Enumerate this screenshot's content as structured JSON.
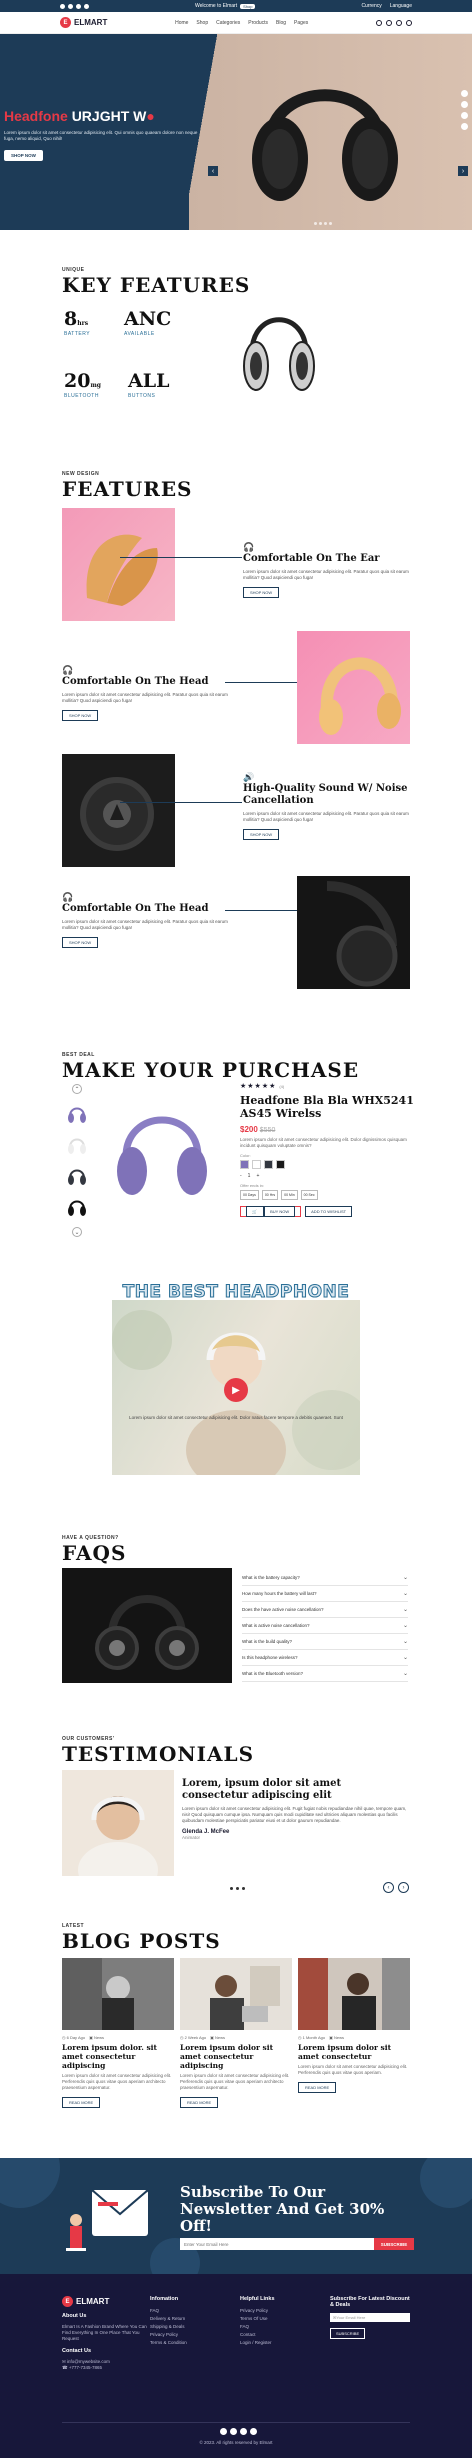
{
  "topbar": {
    "welcome": "Welcome to Elmart",
    "pill": "Shop",
    "currency": "Currency",
    "language": "Language"
  },
  "nav": {
    "logo": "ELMART",
    "menu": [
      "Home",
      "Shop",
      "Categories",
      "Products",
      "Blog",
      "Pages"
    ]
  },
  "hero": {
    "title_a": "Headfone ",
    "title_b": "URJGHT W",
    "desc": "Lorem ipsum dolor sit amet consectetur adipisicing elit. Qui omnis quo quaeam dolore non neque fuga, nemo aliquid, Quo nihil!",
    "button": "SHOP NOW",
    "prev": "‹",
    "next": "›"
  },
  "key_features": {
    "kicker": "UNIQUE",
    "heading": "KEY FEATURES",
    "stats": [
      {
        "num": "8",
        "unit": "hrs",
        "label": "BATTERY"
      },
      {
        "num": "ANC",
        "unit": "",
        "label": "AVAILABLE"
      },
      {
        "num": "20",
        "unit": "mg",
        "label": "BLUETOOTH"
      },
      {
        "num": "ALL",
        "unit": "",
        "label": "BUTTONS"
      }
    ]
  },
  "features": {
    "kicker": "NEW DESIGN",
    "heading": "FEATURES",
    "items": [
      {
        "title": "Comfortable On The Ear",
        "desc": "Lorem ipsum dolor sit amet consectetur adipisicing elit. Paratur quos quia sit earum mollitia? Quod aspiciendi quo fuga!",
        "button": "SHOP NOW"
      },
      {
        "title": "Comfortable On The Head",
        "desc": "Lorem ipsum dolor sit amet consectetur adipisicing elit. Paratur quos quia sit earum mollitia? Quod aspiciendi quo fuga!",
        "button": "SHOP NOW"
      },
      {
        "title": "High-Quality Sound W/ Noise Cancellation",
        "desc": "Lorem ipsum dolor sit amet consectetur adipisicing elit. Paratur quos quia sit earum mollitia? Quod aspiciendi quo fuga!",
        "button": "SHOP NOW"
      },
      {
        "title": "Comfortable On The Head",
        "desc": "Lorem ipsum dolor sit amet consectetur adipisicing elit. Paratur quos quia sit earum mollitia? Quod aspiciendi quo fuga!",
        "button": "SHOP NOW"
      }
    ]
  },
  "purchase": {
    "kicker": "BEST DEAL",
    "heading": "MAKE YOUR PURCHASE",
    "stars": "★★★★★",
    "reviews": "(4)",
    "title": "Headfone Bla Bla WHX5241 AS45 Wirelss",
    "price": "$200",
    "old_price": "$550",
    "desc": "Lorem ipsum dolor sit amet consectetur adipisicing elit. Dolor dignissimos quisquam incidunt quisquam voluptate omnis?",
    "color_label": "Color:",
    "qty_minus": "-",
    "qty": "1",
    "qty_plus": "+",
    "offer_label": "Offer ends in:",
    "offers": [
      "00 Days",
      "00 Hrs",
      "00 Min",
      "00 Sec"
    ],
    "buy": "BUY NOW",
    "wishlist": "ADD TO WISHLIST",
    "colors": [
      "#7f72b8",
      "#ffffff",
      "#333740",
      "#1a1a1a"
    ]
  },
  "video": {
    "title": "THE BEST HEADPHONE",
    "caption": "Lorem ipsum dolor sit amet consectetur adipisicing elit. Dolor natus facere tempore a debitis quaeraet. Sunt"
  },
  "faq": {
    "kicker": "HAVE A QUESTION?",
    "heading": "FAQS",
    "items": [
      "What is the battery capacity?",
      "How many hours the battery will last?",
      "Does the have active noise cancellation?",
      "What is active noise cancellation?",
      "What is the build quality?",
      "Is this headphone wireless?",
      "What is the Bluetooth version?"
    ]
  },
  "testimonials": {
    "kicker": "OUR CUSTOMERS'",
    "heading": "TESTIMONIALS",
    "quote": "Lorem, ipsum dolor sit amet consectetur adipiscing elit",
    "desc": "Lorem ipsum dolor sit amet consectetur adipisicing elit. Fugit fugiat nobis repudiandae nihil quae, tempore quam, nisi! Quod quisquam cumque ipsa. Numquam quis modi cupiditate sed ultricies aliquam molestias quo facilis quibusdam molestiae perspiciatis pariatur eiusi et ut dolor gaurum repudiandae.",
    "name": "Glenda J. McFee",
    "role": "Animator"
  },
  "blog": {
    "kicker": "LATEST",
    "heading": "BLOG POSTS",
    "posts": [
      {
        "date": "6 Day Ago",
        "tag": "News",
        "title": "Lorem ipsum dolor. sit amet consectetur adipiscing",
        "desc": "Lorem ipsum dolor sit amet consectetur adipisicing elit. Perferendis quis quos vitae quos aperiam architecto praesentium aspernatur.",
        "button": "READ MORE"
      },
      {
        "date": "2 Week Ago",
        "tag": "News",
        "title": "Lorem ipsum dolor sit amet consectetur adipiscing",
        "desc": "Lorem ipsum dolor sit amet consectetur adipisicing elit. Perferendis quis quos vitae quos aperiam architecto praesentium aspernatur.",
        "button": "READ MORE"
      },
      {
        "date": "1 Month Ago",
        "tag": "News",
        "title": "Lorem ipsum dolor sit amet consectetur",
        "desc": "Lorem ipsum dolor sit amet consectetur adipisicing elit. Perferendis quis quos vitae quos aperiam.",
        "button": "READ MORE"
      }
    ]
  },
  "newsletter": {
    "title": "Subscribe To Our Newsletter And Get 30% Off!",
    "placeholder": "Enter Your Email Here",
    "button": "SUBSCRIBE"
  },
  "footer": {
    "logo": "ELMART",
    "about_title": "About Us",
    "about_text": "Elmart Is A Fashion Brand Where You Can Find Everything In One Place That You Request",
    "contact_title": "Contact Us",
    "email": "info@mywebsite.com",
    "phone": "+777-7345-7865",
    "info_title": "Infomation",
    "info_links": [
      "FAQ",
      "Delivery & Return",
      "Shipping & Deals",
      "Privacy Policy",
      "Terms & Condition"
    ],
    "help_title": "Helpful Links",
    "help_links": [
      "Privacy Policy",
      "Terms Of Use",
      "FAQ",
      "Contact",
      "Login / Register"
    ],
    "sub_title": "Subscribe For Latest Discount & Deals",
    "sub_placeholder": "Your Email Here",
    "sub_button": "SUBSCRIBE",
    "copyright": "© 2023. All rights reserved by Elmart"
  }
}
